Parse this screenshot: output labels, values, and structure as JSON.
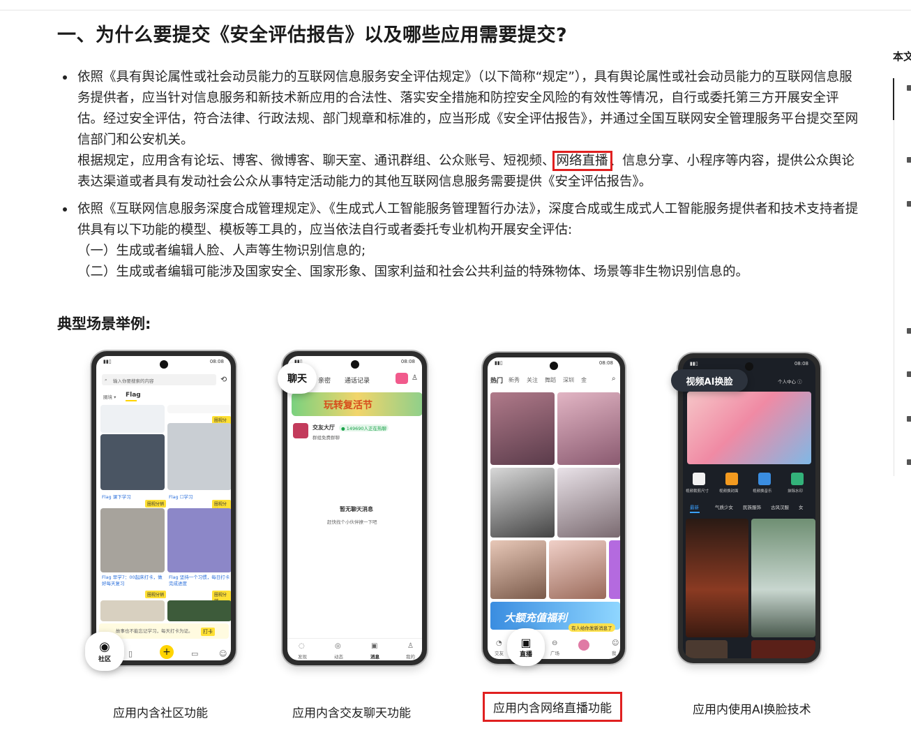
{
  "heading": "一、为什么要提交《安全评估报告》以及哪些应用需要提交?",
  "bullets": [
    {
      "p1": "依照《具有舆论属性或社会动员能力的互联网信息服务安全评估规定》（以下简称“规定”），具有舆论属性或社会动员能力的互联网信息服务提供者，应当针对信息服务和新技术新应用的合法性、落实安全措施和防控安全风险的有效性等情况，自行或委托第三方开展安全评估。经过安全评估，符合法律、行政法规、部门规章和标准的，应当形成《安全评估报告》，并通过全国互联网安全管理服务平台提交至网信部门和公安机关。",
      "p2_before": "根据规定，应用含有论坛、博客、微博客、聊天室、通讯群组、公众账号、短视频、",
      "p2_highlight": "网络直播",
      "p2_after": "、信息分享、小程序等内容，提供公众舆论表达渠道或者具有发动社会公众从事特定活动能力的其他互联网信息服务需要提供《安全评估报告》。"
    },
    {
      "p1": "依照《互联网信息服务深度合成管理规定》、《生成式人工智能服务管理暂行办法》，深度合成或生成式人工智能服务提供者和技术支持者提供具有以下功能的模型、模板等工具的，应当依法自行或者委托专业机构开展安全评估:",
      "items": [
        "（一）生成或者编辑人脸、人声等生物识别信息的;",
        "（二）生成或者编辑可能涉及国家安全、国家形象、国家利益和社会公共利益的特殊物体、场景等非生物识别信息的。"
      ]
    }
  ],
  "subheading": "典型场景举例:",
  "phones": {
    "status_time": "08:08",
    "community": {
      "search_placeholder": "输入你要搜索的内容",
      "tab1": "圈境 ▾",
      "tab2": "Flag",
      "card1_title": "Flag 课下学习",
      "card2_title": "Flag ☐学习",
      "card3_title": "Flag 早学7：00起床打卡，做好每天复习",
      "card4_title": "Flag 坚持一个习惯，每日打卡完成进度",
      "share_chip": "圈视分销",
      "banner_text": "故事也不能忘记学习，每天打卡为证。",
      "banner_btn": "打卡",
      "nav": [
        "社区",
        "",
        "",
        "消息",
        "我"
      ],
      "bubble_label": "社区"
    },
    "chat": {
      "bubble_label": "聊天",
      "tab2": "亲密",
      "tab3": "通话记录",
      "banner": "玩转复活节",
      "row_title": "交友大厅",
      "row_badge": "● 149690人正在热聊",
      "row_sub": "群组免费群聊",
      "empty_title": "暂无聊天消息",
      "empty_sub": "赶快找个小伙伴撩一下吧",
      "nav": [
        "发现",
        "动态",
        "消息",
        "我的"
      ]
    },
    "live": {
      "tabs": [
        "热门",
        "新秀",
        "关注",
        "舞蹈",
        "深圳",
        "金"
      ],
      "banner": "大额充值福利",
      "toast": "有人给你发新消息了",
      "nav": [
        "交友",
        "直播",
        "广场",
        "",
        "我"
      ],
      "bubble_label": "直播"
    },
    "ai": {
      "bubble_label": "视频AI换脸",
      "user_center": "个人中心 ⓘ",
      "tools": [
        "视频裁剪尺寸",
        "视频换封面",
        "视频换音乐",
        "抹除水印"
      ],
      "tabs": [
        "最新",
        "气质少女",
        "民族服饰",
        "古风汉服",
        "女"
      ]
    }
  },
  "captions": [
    "应用内含社区功能",
    "应用内含交友聊天功能",
    "应用内含网络直播功能",
    "应用内使用AI换脸技术"
  ],
  "toc": {
    "label": "本文"
  },
  "colors": {
    "highlight": "#e02020",
    "accent_yellow": "#ffe033"
  }
}
